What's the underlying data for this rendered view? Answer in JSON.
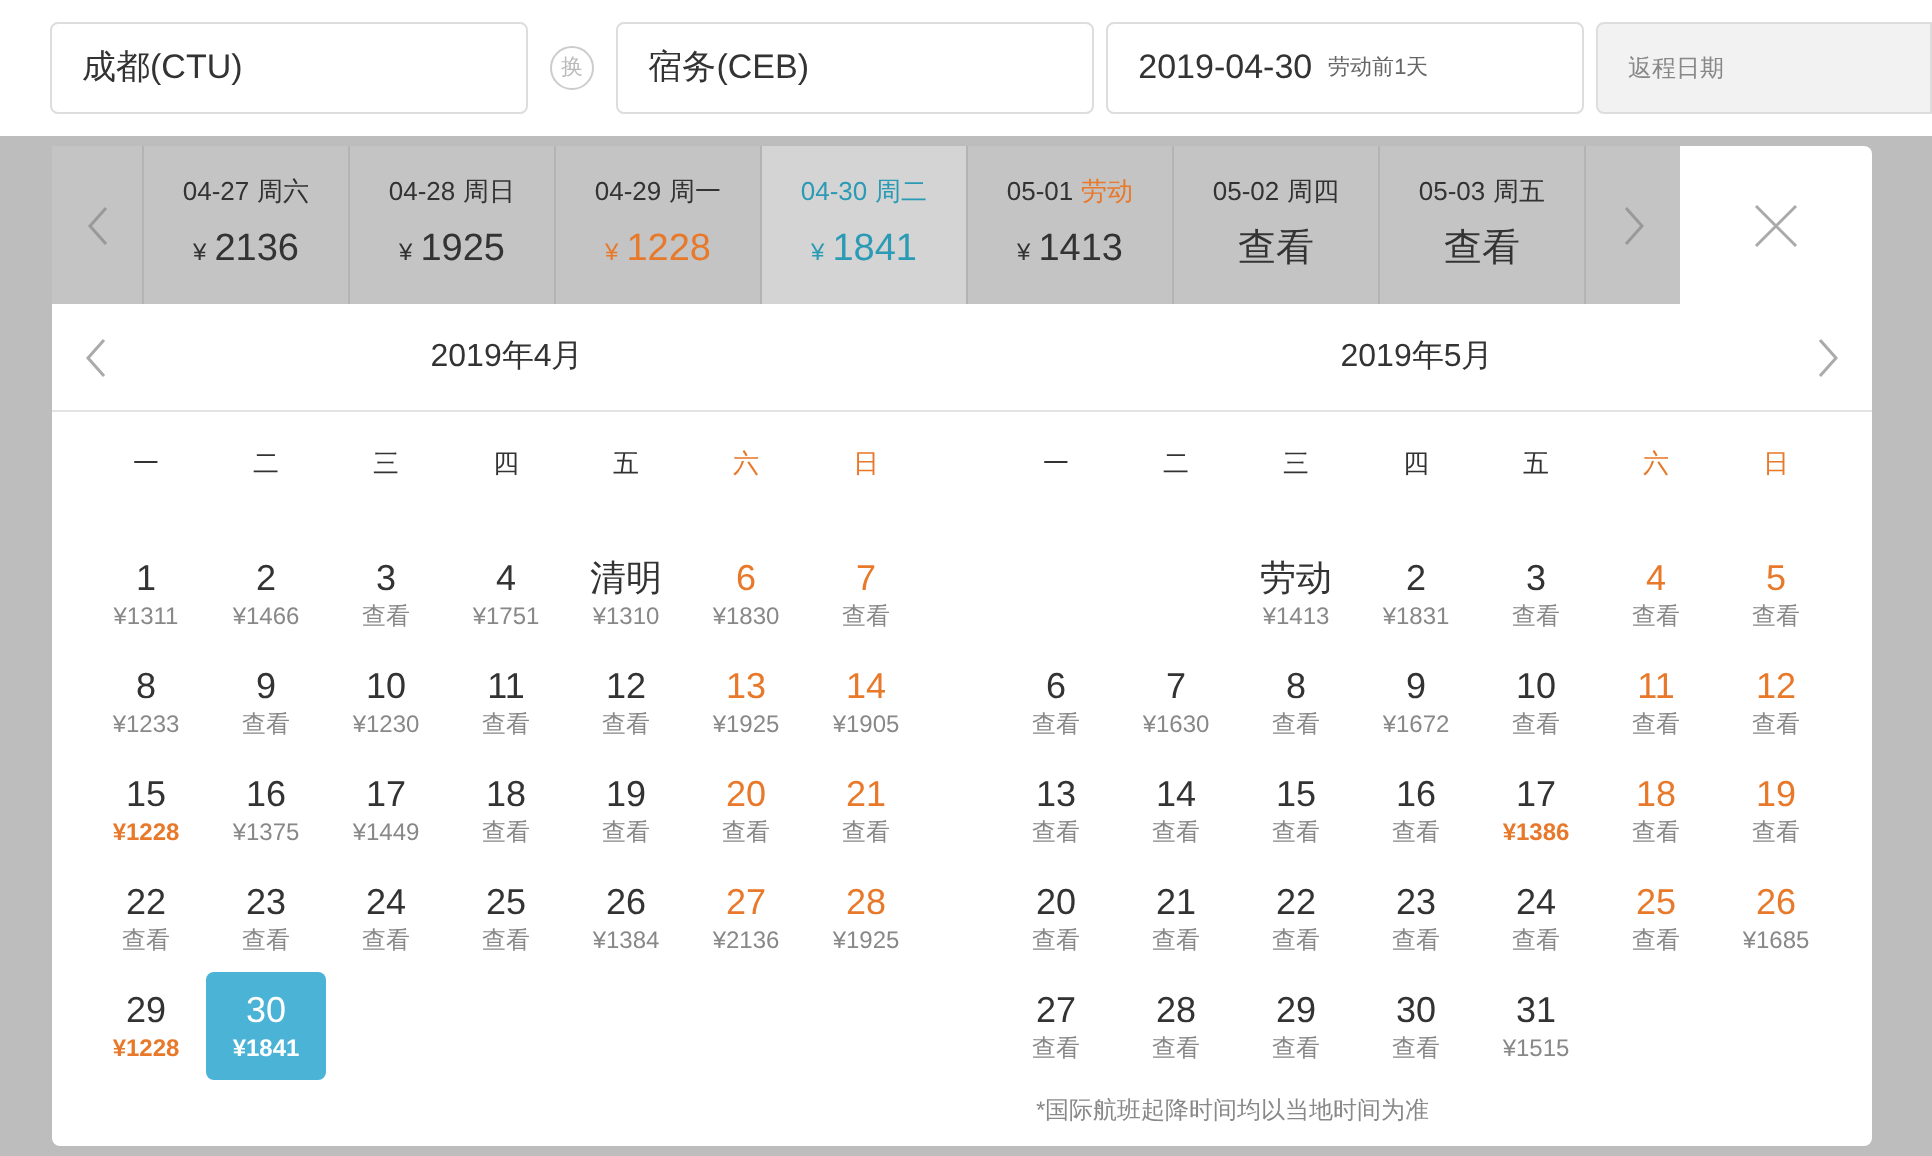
{
  "search": {
    "from": "成都(CTU)",
    "swap": "换",
    "to": "宿务(CEB)",
    "date": "2019-04-30",
    "date_note": "劳动前1天",
    "return_placeholder": "返程日期"
  },
  "date_strip": [
    {
      "date": "04-27",
      "weekday": "周六",
      "price": "2136",
      "selected": false,
      "holiday": false,
      "low": false
    },
    {
      "date": "04-28",
      "weekday": "周日",
      "price": "1925",
      "selected": false,
      "holiday": false,
      "low": false
    },
    {
      "date": "04-29",
      "weekday": "周一",
      "price": "1228",
      "selected": false,
      "holiday": false,
      "low": true
    },
    {
      "date": "04-30",
      "weekday": "周二",
      "price": "1841",
      "selected": true,
      "holiday": false,
      "low": false
    },
    {
      "date": "05-01",
      "weekday": "劳动",
      "price": "1413",
      "selected": false,
      "holiday": true,
      "low": false
    },
    {
      "date": "05-02",
      "weekday": "周四",
      "price": "查看",
      "selected": false,
      "holiday": false,
      "low": false,
      "kind": "view"
    },
    {
      "date": "05-03",
      "weekday": "周五",
      "price": "查看",
      "selected": false,
      "holiday": false,
      "low": false,
      "kind": "view"
    }
  ],
  "currency": "¥",
  "months": [
    {
      "title": "2019年4月",
      "weekdays": [
        "一",
        "二",
        "三",
        "四",
        "五",
        "六",
        "日"
      ],
      "weeks": [
        [
          {
            "day": "1",
            "price": "¥1311"
          },
          {
            "day": "2",
            "price": "¥1466"
          },
          {
            "day": "3",
            "price": "查看"
          },
          {
            "day": "4",
            "price": "¥1751"
          },
          {
            "day": "清明",
            "price": "¥1310"
          },
          {
            "day": "6",
            "price": "¥1830"
          },
          {
            "day": "7",
            "price": "查看"
          }
        ],
        [
          {
            "day": "8",
            "price": "¥1233"
          },
          {
            "day": "9",
            "price": "查看"
          },
          {
            "day": "10",
            "price": "¥1230"
          },
          {
            "day": "11",
            "price": "查看"
          },
          {
            "day": "12",
            "price": "查看"
          },
          {
            "day": "13",
            "price": "¥1925"
          },
          {
            "day": "14",
            "price": "¥1905"
          }
        ],
        [
          {
            "day": "15",
            "price": "¥1228",
            "low": true
          },
          {
            "day": "16",
            "price": "¥1375"
          },
          {
            "day": "17",
            "price": "¥1449"
          },
          {
            "day": "18",
            "price": "查看"
          },
          {
            "day": "19",
            "price": "查看"
          },
          {
            "day": "20",
            "price": "查看"
          },
          {
            "day": "21",
            "price": "查看"
          }
        ],
        [
          {
            "day": "22",
            "price": "查看"
          },
          {
            "day": "23",
            "price": "查看"
          },
          {
            "day": "24",
            "price": "查看"
          },
          {
            "day": "25",
            "price": "查看"
          },
          {
            "day": "26",
            "price": "¥1384"
          },
          {
            "day": "27",
            "price": "¥2136"
          },
          {
            "day": "28",
            "price": "¥1925"
          }
        ],
        [
          {
            "day": "29",
            "price": "¥1228",
            "low": true
          },
          {
            "day": "30",
            "price": "¥1841",
            "selected": true
          }
        ]
      ]
    },
    {
      "title": "2019年5月",
      "weekdays": [
        "一",
        "二",
        "三",
        "四",
        "五",
        "六",
        "日"
      ],
      "weeks": [
        [
          {
            "day": "劳动",
            "price": "¥1413"
          },
          {
            "day": "2",
            "price": "¥1831"
          },
          {
            "day": "3",
            "price": "查看"
          },
          {
            "day": "4",
            "price": "查看"
          },
          {
            "day": "5",
            "price": "查看"
          }
        ],
        [
          {
            "day": "6",
            "price": "查看"
          },
          {
            "day": "7",
            "price": "¥1630"
          },
          {
            "day": "8",
            "price": "查看"
          },
          {
            "day": "9",
            "price": "¥1672"
          },
          {
            "day": "10",
            "price": "查看"
          },
          {
            "day": "11",
            "price": "查看"
          },
          {
            "day": "12",
            "price": "查看"
          }
        ],
        [
          {
            "day": "13",
            "price": "查看"
          },
          {
            "day": "14",
            "price": "查看"
          },
          {
            "day": "15",
            "price": "查看"
          },
          {
            "day": "16",
            "price": "查看"
          },
          {
            "day": "17",
            "price": "¥1386",
            "low": true
          },
          {
            "day": "18",
            "price": "查看"
          },
          {
            "day": "19",
            "price": "查看"
          }
        ],
        [
          {
            "day": "20",
            "price": "查看"
          },
          {
            "day": "21",
            "price": "查看"
          },
          {
            "day": "22",
            "price": "查看"
          },
          {
            "day": "23",
            "price": "查看"
          },
          {
            "day": "24",
            "price": "查看"
          },
          {
            "day": "25",
            "price": "查看"
          },
          {
            "day": "26",
            "price": "¥1685"
          }
        ],
        [
          {
            "day": "27",
            "price": "查看"
          },
          {
            "day": "28",
            "price": "查看"
          },
          {
            "day": "29",
            "price": "查看"
          },
          {
            "day": "30",
            "price": "查看"
          },
          {
            "day": "31",
            "price": "¥1515"
          }
        ]
      ],
      "note": "*国际航班起降时间均以当地时间为准"
    }
  ]
}
